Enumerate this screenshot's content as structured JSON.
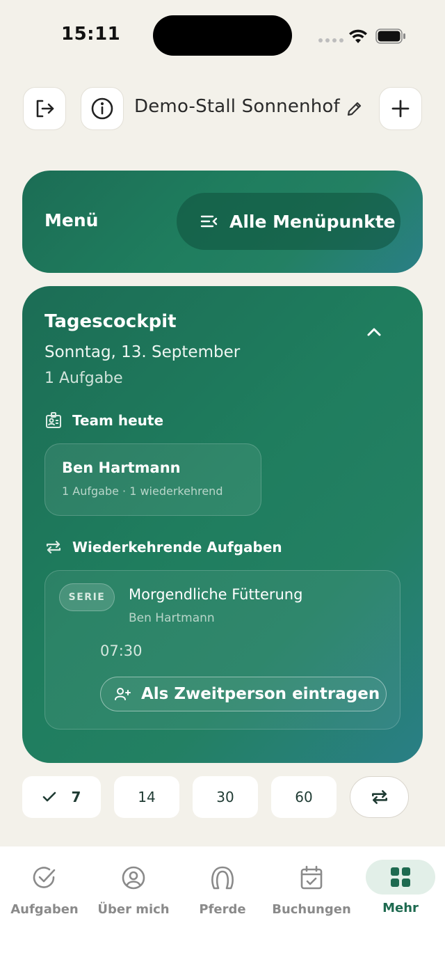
{
  "status_bar": {
    "time": "15:11"
  },
  "header": {
    "stable_name": "Demo-Stall Sonnenhof",
    "icons": [
      "logout-icon",
      "info-icon",
      "edit-icon",
      "plus-icon"
    ]
  },
  "menu_card": {
    "title": "Menü",
    "all_items_label": "Alle Menüpunkte"
  },
  "cockpit": {
    "title": "Tagescockpit",
    "date": "Sonntag, 13. September",
    "task_count": "1 Aufgabe",
    "team_section_label": "Team heute",
    "team": [
      {
        "name": "Ben Hartmann",
        "summary": "1 Aufgabe · 1 wiederkehrend"
      }
    ],
    "recurring_section_label": "Wiederkehrende Aufgaben",
    "recurring_tasks": [
      {
        "badge": "SERIE",
        "title": "Morgendliche Fütterung",
        "assignee": "Ben Hartmann",
        "time": "07:30",
        "action_label": "Als Zweitperson eintragen"
      }
    ]
  },
  "range_chips": {
    "selected": "7",
    "options": [
      "7",
      "14",
      "30",
      "60"
    ]
  },
  "tab_bar": {
    "tabs": [
      {
        "label": "Aufgaben",
        "icon": "check-circle-icon"
      },
      {
        "label": "Über mich",
        "icon": "user-circle-icon"
      },
      {
        "label": "Pferde",
        "icon": "horseshoe-icon"
      },
      {
        "label": "Buchungen",
        "icon": "calendar-check-icon"
      },
      {
        "label": "Mehr",
        "icon": "grid-icon"
      }
    ],
    "active": "Mehr"
  },
  "colors": {
    "background": "#f3f1ea",
    "card_green": "#1f7d5e",
    "accent": "#1e6a50"
  }
}
